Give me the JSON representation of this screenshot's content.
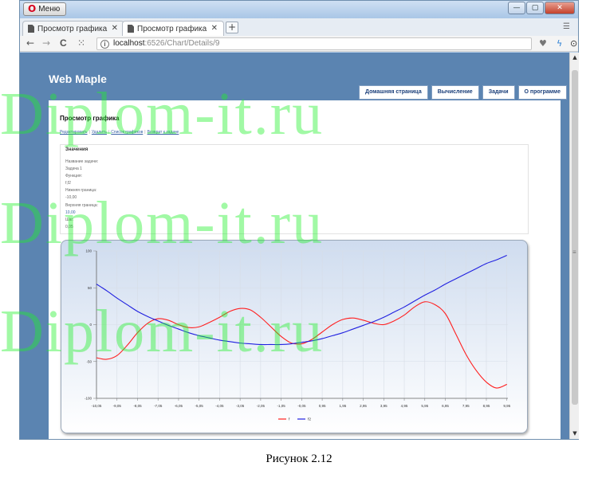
{
  "browser": {
    "menu_label": "Меню",
    "tabs": [
      {
        "label": "Просмотр графика",
        "close": "✕"
      },
      {
        "label": "Просмотр графика",
        "close": "✕"
      }
    ],
    "new_tab": "+",
    "url_host": "localhost",
    "url_path": ":6526/Chart/Details/9",
    "window_controls": {
      "minimize": "—",
      "maximize": "▢",
      "close": "✕"
    },
    "nav": {
      "back": "←",
      "forward": "→",
      "reload": "C",
      "speed_dial": "⁙"
    },
    "toolbar_icons": [
      "heart-icon",
      "bolt-icon",
      "download-icon"
    ]
  },
  "site": {
    "title": "Web Maple",
    "nav": [
      "Домашняя страница",
      "Вычисление",
      "Задачи",
      "О программе"
    ]
  },
  "page": {
    "title": "Просмотр графика",
    "links": [
      "Редактировать",
      "Удалить",
      "Список графиков",
      "Возврат к задаче"
    ],
    "values": {
      "heading": "Значения",
      "task_label": "Название задачи:",
      "task_value": "Задача 1",
      "function_label": "Функция:",
      "function_value": "f,f2",
      "lower_label": "Нижняя граница:",
      "lower_value": "-10,00",
      "upper_label": "Верхняя граница:",
      "upper_value": "10,00",
      "step_label": "Шаг:",
      "step_value": "0,05"
    }
  },
  "chart_data": {
    "type": "line",
    "title": "",
    "xlabel": "",
    "ylabel": "",
    "xlim": [
      -10.05,
      10.0
    ],
    "ylim": [
      -100,
      100
    ],
    "x_ticks": [
      "-10,05",
      "-9,05",
      "-8,05",
      "-7,05",
      "-6,05",
      "-5,05",
      "-4,05",
      "-3,05",
      "-2,05",
      "-1,05",
      "-0,05",
      "0,95",
      "1,95",
      "2,95",
      "3,95",
      "4,95",
      "5,95",
      "6,95",
      "7,95",
      "8,95",
      "9,95"
    ],
    "y_ticks": [
      100,
      50,
      0,
      -50,
      -100
    ],
    "grid": true,
    "legend": "bottom-center",
    "series": [
      {
        "name": "f",
        "color": "#ff2020",
        "x": [
          -10.05,
          -9.55,
          -9.05,
          -8.55,
          -8.05,
          -7.55,
          -7.05,
          -6.55,
          -6.05,
          -5.55,
          -5.05,
          -4.55,
          -4.05,
          -3.55,
          -3.05,
          -2.55,
          -2.05,
          -1.55,
          -1.05,
          -0.55,
          -0.05,
          0.45,
          0.95,
          1.45,
          1.95,
          2.45,
          2.95,
          3.45,
          3.95,
          4.45,
          4.95,
          5.45,
          5.95,
          6.45,
          6.95,
          7.45,
          7.95,
          8.45,
          8.95,
          9.45,
          9.95
        ],
        "y": [
          -45,
          -47,
          -42,
          -28,
          -11,
          2,
          8,
          6,
          0,
          -4,
          -3,
          3,
          10,
          18,
          22,
          20,
          10,
          -3,
          -16,
          -25,
          -26,
          -20,
          -10,
          0,
          7,
          9,
          6,
          2,
          0,
          5,
          13,
          24,
          31,
          27,
          15,
          -12,
          -40,
          -62,
          -78,
          -86,
          -81
        ]
      },
      {
        "name": "f2",
        "color": "#2020e0",
        "x": [
          -10.05,
          -9.55,
          -9.05,
          -8.55,
          -8.05,
          -7.55,
          -7.05,
          -6.55,
          -6.05,
          -5.55,
          -5.05,
          -4.55,
          -4.05,
          -3.55,
          -3.05,
          -2.55,
          -2.05,
          -1.55,
          -1.05,
          -0.55,
          -0.05,
          0.45,
          0.95,
          1.45,
          1.95,
          2.45,
          2.95,
          3.45,
          3.95,
          4.45,
          4.95,
          5.45,
          5.95,
          6.45,
          6.95,
          7.45,
          7.95,
          8.45,
          8.95,
          9.45,
          9.95
        ],
        "y": [
          55,
          46,
          36,
          27,
          18,
          11,
          5,
          -1,
          -6,
          -11,
          -15,
          -18,
          -21,
          -23,
          -25,
          -26,
          -27,
          -27,
          -27,
          -26,
          -24,
          -22,
          -19,
          -15,
          -11,
          -6,
          -1,
          4,
          10,
          17,
          24,
          32,
          40,
          47,
          55,
          62,
          69,
          76,
          83,
          88,
          94
        ]
      }
    ]
  },
  "caption": "Рисунок 2.12",
  "watermark": "Diplom-it.ru"
}
